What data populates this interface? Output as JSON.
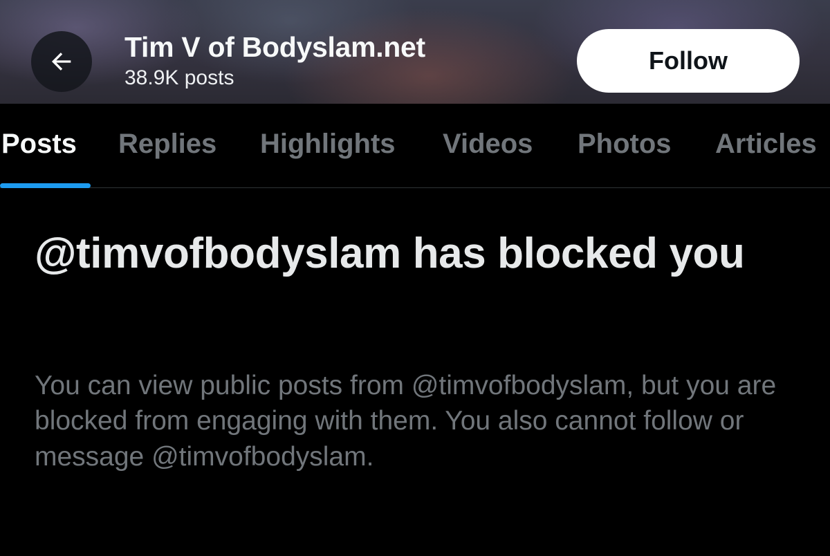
{
  "header": {
    "profile_name": "Tim V of Bodyslam.net",
    "post_count": "38.9K posts",
    "back_icon": "arrow-left-icon",
    "follow_label": "Follow"
  },
  "tabs": [
    {
      "label": "Posts",
      "active": true
    },
    {
      "label": "Replies",
      "active": false
    },
    {
      "label": "Highlights",
      "active": false
    },
    {
      "label": "Videos",
      "active": false
    },
    {
      "label": "Photos",
      "active": false
    },
    {
      "label": "Articles",
      "active": false
    }
  ],
  "blocked": {
    "heading": "@timvofbodyslam has blocked you",
    "message": "You can view public posts from @timvofbodyslam, but you are blocked from engaging with them. You also cannot follow or message @timvofbodyslam."
  },
  "colors": {
    "background": "#000000",
    "accent": "#1d9bf0",
    "muted_text": "#71767b",
    "primary_text": "#e7e9ea",
    "follow_button_bg": "#ffffff"
  }
}
